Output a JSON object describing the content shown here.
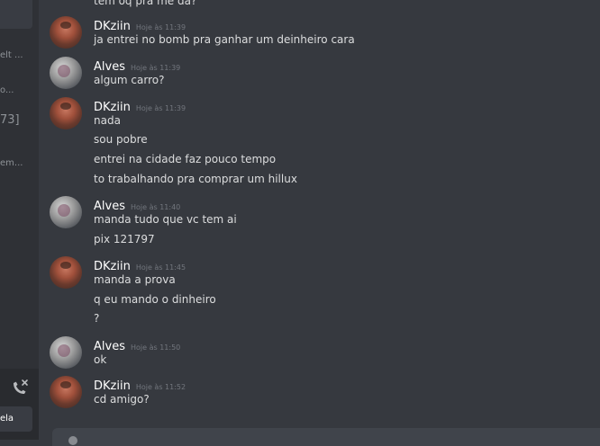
{
  "sidebar": {
    "fragments": [
      "elt ...",
      "o...",
      "73]",
      "em..."
    ],
    "bottom_label": "ela"
  },
  "chat": {
    "top_partial": "tem oq pra me da?",
    "messages": [
      {
        "author": "DKziin",
        "time": "Hoje às 11:39",
        "avatar": "dk",
        "lines": [
          "ja entrei no bomb pra ganhar um deinheiro cara"
        ]
      },
      {
        "author": "Alves",
        "time": "Hoje às 11:39",
        "avatar": "al",
        "lines": [
          "algum carro?"
        ]
      },
      {
        "author": "DKziin",
        "time": "Hoje às 11:39",
        "avatar": "dk",
        "lines": [
          "nada",
          "sou pobre",
          "entrei na cidade faz pouco tempo",
          "to trabalhando pra comprar um hillux"
        ]
      },
      {
        "author": "Alves",
        "time": "Hoje às 11:40",
        "avatar": "al",
        "lines": [
          "manda tudo que vc tem ai",
          "pix 121797"
        ]
      },
      {
        "author": "DKziin",
        "time": "Hoje às 11:45",
        "avatar": "dk",
        "lines": [
          "manda a prova",
          "q eu mando o dinheiro",
          "?"
        ]
      },
      {
        "author": "Alves",
        "time": "Hoje às 11:50",
        "avatar": "al",
        "lines": [
          "ok"
        ]
      },
      {
        "author": "DKziin",
        "time": "Hoje às 11:52",
        "avatar": "dk",
        "lines": [
          "cd amigo?"
        ]
      }
    ]
  },
  "icons": {
    "call": "phone-hangup-icon",
    "avatar_dk": "avatar-dkziin",
    "avatar_alves": "avatar-alves"
  }
}
